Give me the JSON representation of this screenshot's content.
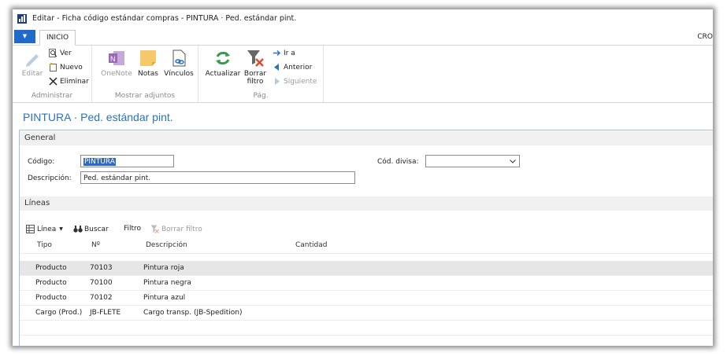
{
  "window": {
    "title": "Editar - Ficha código estándar compras - PINTURA · Ped. estándar pint."
  },
  "tabs": {
    "file": "▼",
    "home": "INICIO",
    "company_partial": "CRO"
  },
  "ribbon": {
    "administrar": {
      "label": "Administrar",
      "edit": "Editar",
      "view": "Ver",
      "new": "Nuevo",
      "delete": "Eliminar"
    },
    "adjuntos": {
      "label": "Mostrar adjuntos",
      "onenote": "OneNote",
      "notes": "Notas",
      "links": "Vínculos"
    },
    "pag": {
      "label": "Pág.",
      "refresh": "Actualizar",
      "clear_filter_1": "Borrar",
      "clear_filter_2": "filtro",
      "goto": "Ir a",
      "previous": "Anterior",
      "next": "Siguiente"
    }
  },
  "page": {
    "title": "PINTURA · Ped. estándar pint."
  },
  "general": {
    "header": "General",
    "code_label": "Código:",
    "code_value": "PINTURA",
    "desc_label": "Descripción:",
    "desc_value": "Ped. estándar pint.",
    "currency_label": "Cód. divisa:",
    "currency_value": ""
  },
  "lines": {
    "header": "Líneas",
    "toolbar": {
      "line": "Línea",
      "search": "Buscar",
      "filter": "Filtro",
      "clear_filter": "Borrar filtro"
    },
    "columns": {
      "type": "Tipo",
      "no": "Nº",
      "description": "Descripción",
      "quantity": "Cantidad"
    },
    "rows": [
      {
        "type": "Producto",
        "no": "70103",
        "description": "Pintura roja",
        "quantity": ""
      },
      {
        "type": "Producto",
        "no": "70100",
        "description": "Pintura negra",
        "quantity": ""
      },
      {
        "type": "Producto",
        "no": "70102",
        "description": "Pintura azul",
        "quantity": ""
      },
      {
        "type": "Cargo (Prod.)",
        "no": "JB-FLETE",
        "description": "Cargo transp. (JB-Spedition)",
        "quantity": ""
      }
    ]
  },
  "colors": {
    "accent": "#2a73c1",
    "file_tab": "#1e6bc9",
    "selection": "#2e68c6",
    "frame_border": "#9fc2e6"
  }
}
